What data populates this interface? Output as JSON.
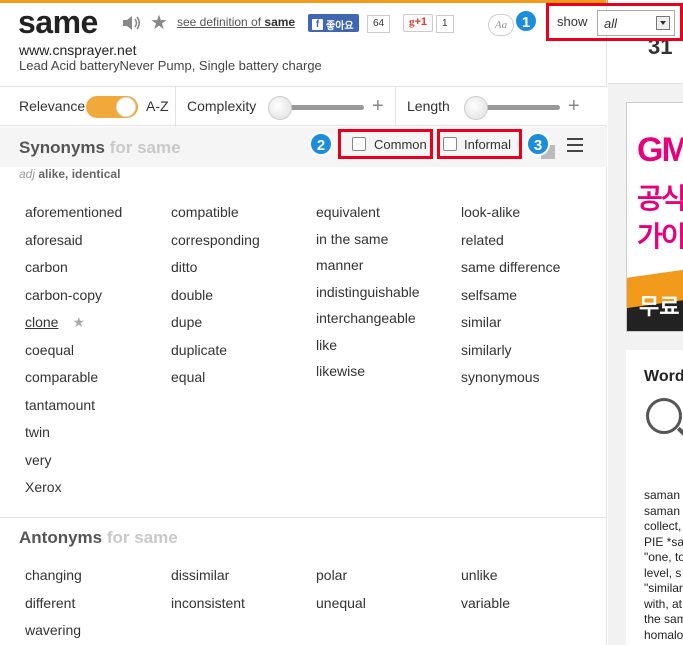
{
  "header": {
    "word": "same",
    "see_definition_prefix": "see definition of ",
    "see_definition_word": "same",
    "facebook_label": "좋아요",
    "facebook_count": "64",
    "gplus_label": "+1",
    "gplus_count": "1",
    "font_size_label": "Aa",
    "show_label": "show",
    "show_value": "all"
  },
  "ad": {
    "url": "www.cnsprayer.net",
    "text": "Lead Acid batteryNever Pump, Single battery charge"
  },
  "filters": {
    "relevance": "Relevance",
    "az": "A-Z",
    "complexity": "Complexity",
    "length": "Length",
    "plus": "+"
  },
  "badges": [
    "1",
    "2",
    "3"
  ],
  "synonyms": {
    "title": "Synonyms",
    "for": "for same",
    "pos": "adj",
    "sense": "alike, identical",
    "common_label": "Common",
    "informal_label": "Informal",
    "columns": [
      [
        "aforementioned",
        "aforesaid",
        "carbon",
        "carbon-copy",
        "clone",
        "coequal",
        "comparable",
        "tantamount",
        "twin",
        "very",
        "Xerox"
      ],
      [
        "compatible",
        "corresponding",
        "ditto",
        "double",
        "dupe",
        "duplicate",
        "equal"
      ],
      [
        "equivalent",
        "in the same",
        "manner",
        "indistinguishable",
        "interchangeable",
        "like",
        "likewise"
      ],
      [
        "look-alike",
        "related",
        "same difference",
        "selfsame",
        "similar",
        "similarly",
        "synonymous"
      ]
    ]
  },
  "antonyms": {
    "title": "Antonyms",
    "for": "for same",
    "columns": [
      [
        "changing",
        "different",
        "wavering"
      ],
      [
        "dissimilar",
        "inconsistent"
      ],
      [
        "polar",
        "unequal"
      ],
      [
        "unlike",
        "variable"
      ]
    ]
  },
  "side": {
    "number": "31",
    "ad_line1": "GM",
    "ad_line2": "공식",
    "ad_line3": "가이",
    "ad_bottom": "무료",
    "word_origin_title": "Word Origin",
    "etymology_lines": [
      "saman",
      "saman",
      "collect,",
      "PIE *sa",
      "\"one, to",
      "level, s",
      "\"similar",
      "with, at",
      "the sam",
      "homalo"
    ]
  },
  "colors": {
    "accent": "#f29a1b",
    "badge": "#1c8ddb",
    "highlight": "#e8001c",
    "facebook": "#4267b2"
  }
}
